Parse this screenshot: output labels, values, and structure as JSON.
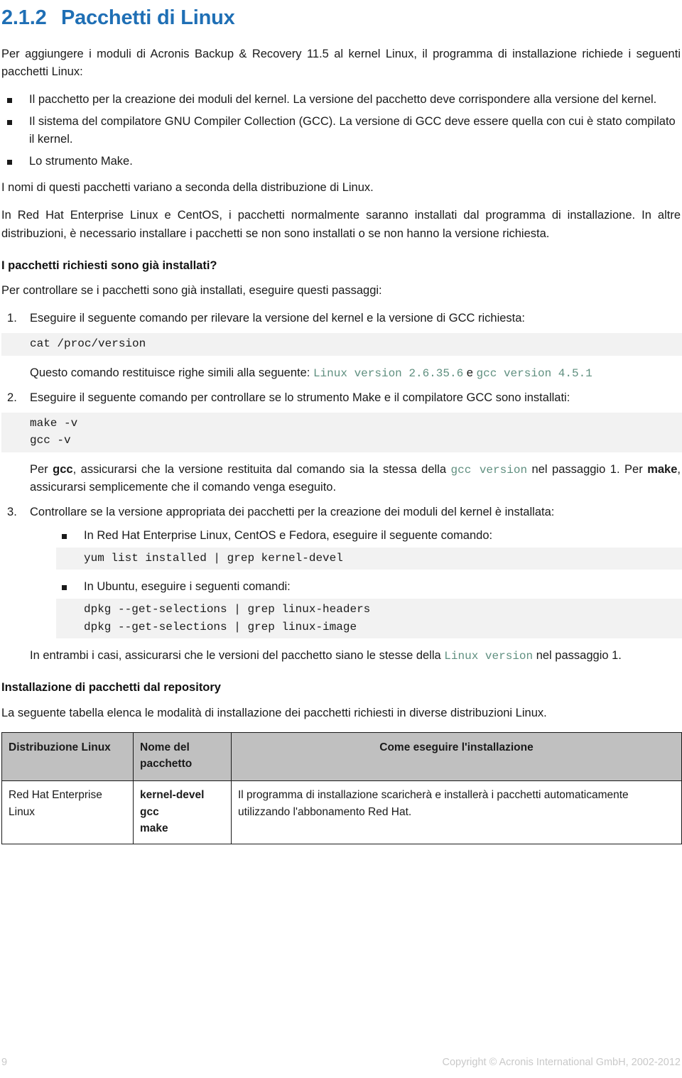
{
  "heading": {
    "number": "2.1.2",
    "title": "Pacchetti di Linux"
  },
  "intro": {
    "paragraph": "Per aggiungere i moduli di Acronis Backup & Recovery 11.5 al kernel Linux, il programma di installazione richiede i seguenti pacchetti Linux:"
  },
  "requirements": [
    "Il pacchetto per la creazione dei moduli del kernel. La versione del pacchetto deve corrispondere alla versione del kernel.",
    "Il sistema del compilatore GNU Compiler Collection (GCC). La versione di GCC deve essere quella con cui è stato compilato il kernel.",
    "Lo strumento Make."
  ],
  "after_requirements": {
    "names_vary": "I nomi di questi pacchetti variano a seconda della distribuzione di Linux.",
    "redhat_note": "In Red Hat Enterprise Linux e CentOS, i pacchetti normalmente saranno installati dal programma di installazione. In altre distribuzioni, è necessario installare i pacchetti se non sono installati o se non hanno la versione richiesta."
  },
  "already_installed": {
    "heading": "I pacchetti richiesti sono già installati?",
    "lead": "Per controllare se i pacchetti sono già installati, eseguire questi passaggi:",
    "steps": [
      {
        "text": "Eseguire il seguente comando per rilevare la versione del kernel e la versione di GCC richiesta:",
        "code": "cat /proc/version",
        "note_prefix": "Questo comando restituisce righe simili alla seguente: ",
        "note_code1": "Linux version 2.6.35.6",
        "note_mid": " e ",
        "note_code2": "gcc version 4.5.1"
      },
      {
        "text": "Eseguire il seguente comando per controllare se lo strumento Make e il compilatore GCC sono installati:",
        "code": "make -v\ngcc -v",
        "note_p1": "Per ",
        "note_b1": "gcc",
        "note_p2": ", assicurarsi che la versione restituita dal comando sia la stessa della ",
        "note_code": "gcc version",
        "note_p3": " nel passaggio 1. Per ",
        "note_b2": "make",
        "note_p4": ", assicurarsi semplicemente che il comando venga eseguito."
      },
      {
        "text": "Controllare se la versione appropriata dei pacchetti per la creazione dei moduli del kernel è installata:",
        "substeps": [
          {
            "text": "In Red Hat Enterprise Linux, CentOS e Fedora, eseguire il seguente comando:",
            "code": "yum list installed | grep kernel-devel"
          },
          {
            "text": "In Ubuntu, eseguire i seguenti comandi:",
            "code": "dpkg --get-selections | grep linux-headers\ndpkg --get-selections | grep linux-image"
          }
        ]
      }
    ],
    "closing_prefix": "In entrambi i casi, assicurarsi che le versioni del pacchetto siano le stesse della ",
    "closing_code": "Linux version",
    "closing_suffix": " nel passaggio 1."
  },
  "repository": {
    "heading": "Installazione di pacchetti dal repository",
    "lead": "La seguente tabella elenca le modalità di installazione dei pacchetti richiesti in diverse distribuzioni Linux.",
    "table": {
      "columns": [
        "Distribuzione Linux",
        "Nome del pacchetto",
        "Come eseguire l'installazione"
      ],
      "rows": [
        {
          "distribution": "Red Hat Enterprise Linux",
          "packages": [
            "kernel-devel",
            "gcc",
            "make"
          ],
          "howto": "Il programma di installazione scaricherà e installerà i pacchetti automaticamente utilizzando l'abbonamento Red Hat."
        }
      ]
    }
  },
  "footer": {
    "page_number": "9",
    "copyright": "Copyright © Acronis International GmbH, 2002-2012"
  },
  "colors": {
    "heading_blue": "#1F6FB5",
    "code_green": "#5F8F7F",
    "code_bg": "#F2F2F2",
    "table_header_bg": "#C0C0C0",
    "footer_gray": "#C9C9C9"
  }
}
